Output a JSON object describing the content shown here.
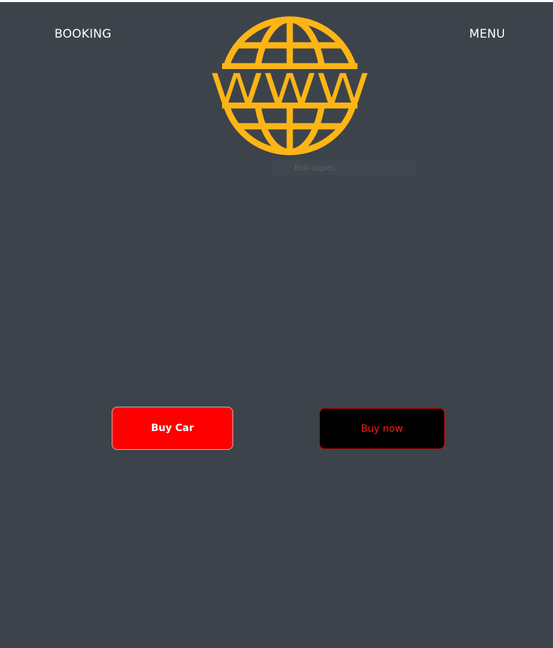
{
  "nav": {
    "booking_label": "BOOKING",
    "menu_label": "MENU"
  },
  "logo": {
    "text": "WWW",
    "icon": "globe-icon",
    "color": "#fdb515"
  },
  "search": {
    "placeholder": "Веб-адрес",
    "value": ""
  },
  "buttons": {
    "buy_car_label": "Buy Car",
    "buy_now_label": "Buy now"
  },
  "colors": {
    "background": "#3d434a",
    "buy_car_bg": "#ff0000",
    "buy_now_bg": "#000000",
    "buy_now_text": "#ff1a1a"
  }
}
